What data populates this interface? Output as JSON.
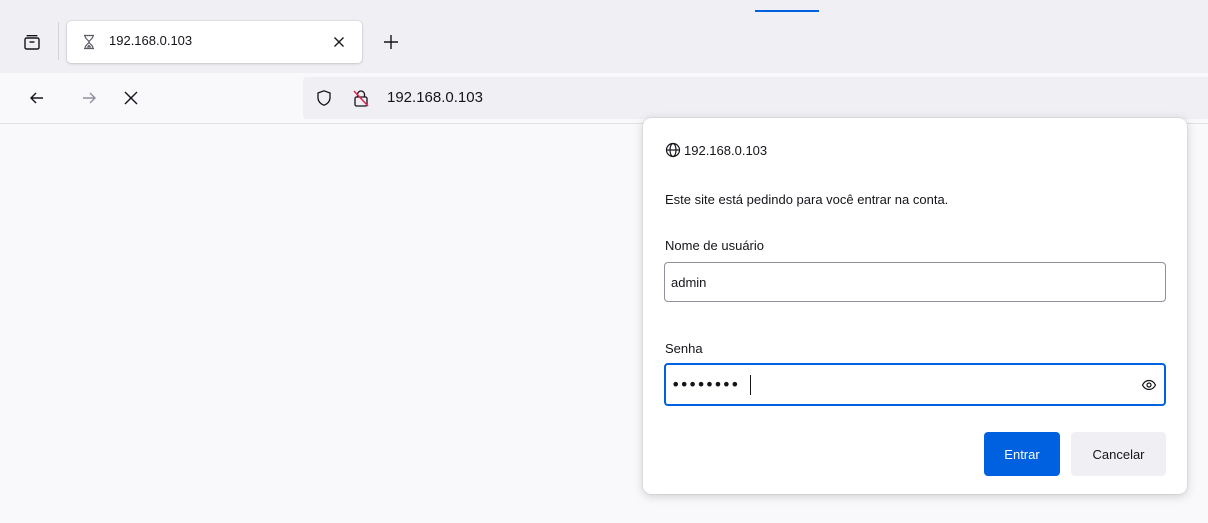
{
  "tab": {
    "title": "192.168.0.103",
    "status_icon": "hourglass-icon"
  },
  "toolbar": {
    "back_icon": "arrow-left-icon",
    "forward_icon": "arrow-right-icon",
    "stop_icon": "close-icon"
  },
  "url_bar": {
    "text": "192.168.0.103",
    "tracking_icon": "shield-icon",
    "security_icon": "lock-insecure-icon"
  },
  "auth_dialog": {
    "origin": "192.168.0.103",
    "message": "Este site está pedindo para você entrar na conta.",
    "username_label": "Nome de usuário",
    "username_value": "admin",
    "password_label": "Senha",
    "password_masked": "••••••••",
    "submit_label": "Entrar",
    "cancel_label": "Cancelar"
  },
  "colors": {
    "accent": "#0061e0",
    "chrome": "#f0f0f4",
    "page": "#f9f9fb"
  }
}
